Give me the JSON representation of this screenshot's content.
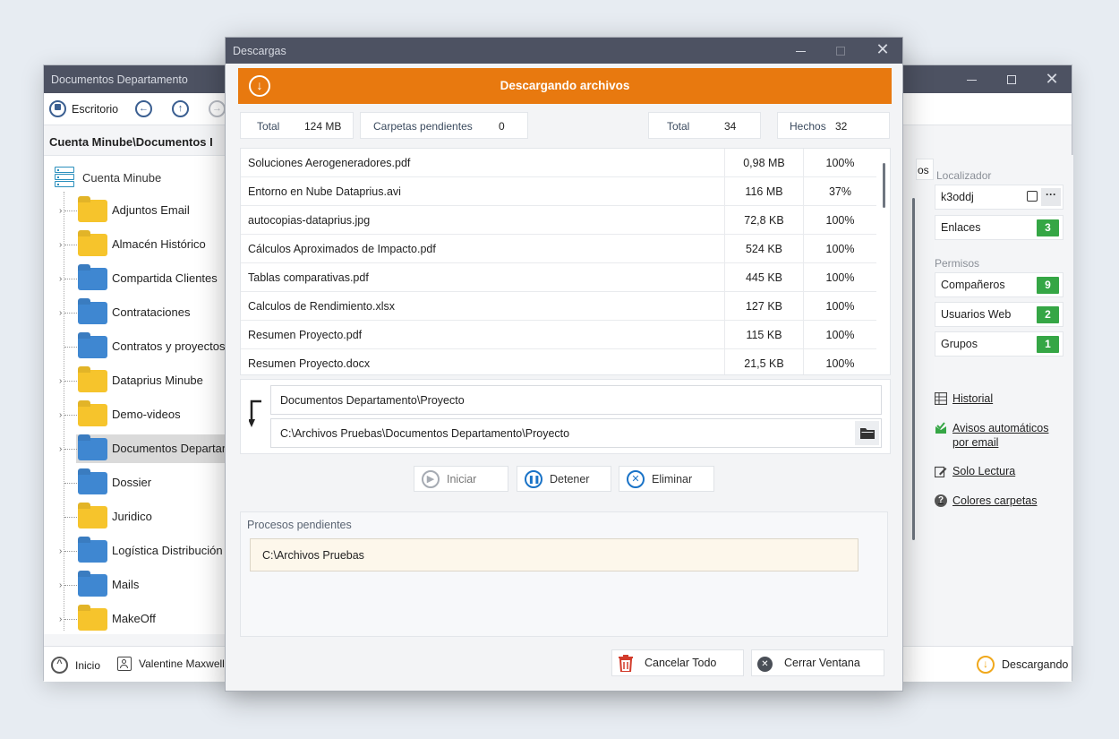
{
  "main_window": {
    "title": "Documentos Departamento",
    "toolbar": {
      "escritorio_label": "Escritorio"
    },
    "breadcrumb": "Cuenta Minube\\Documentos I",
    "tree": {
      "root_label": "Cuenta Minube",
      "items": [
        {
          "label": "Adjuntos Email",
          "color": "yellow",
          "has_children": true
        },
        {
          "label": "Almacén Histórico",
          "color": "yellow",
          "has_children": true
        },
        {
          "label": "Compartida Clientes",
          "color": "blue",
          "has_children": true
        },
        {
          "label": "Contrataciones",
          "color": "blue",
          "has_children": true
        },
        {
          "label": "Contratos y proyectos",
          "color": "blue",
          "has_children": false
        },
        {
          "label": "Dataprius Minube",
          "color": "yellow",
          "has_children": true
        },
        {
          "label": "Demo-videos",
          "color": "yellow",
          "has_children": true
        },
        {
          "label": "Documentos Departam",
          "color": "blue",
          "has_children": true,
          "selected": true
        },
        {
          "label": "Dossier",
          "color": "blue",
          "has_children": false
        },
        {
          "label": "Juridico",
          "color": "yellow",
          "has_children": false
        },
        {
          "label": "Logística Distribución",
          "color": "blue",
          "has_children": true
        },
        {
          "label": "Mails",
          "color": "blue",
          "has_children": true
        },
        {
          "label": "MakeOff",
          "color": "yellow",
          "has_children": true
        }
      ]
    },
    "statusbar": {
      "inicio_label": "Inicio",
      "user_label": "Valentine Maxwell",
      "downloading_label": "Descargando"
    },
    "right_panel": {
      "localizador_label": "Localizador",
      "localizador_value": "k3oddj",
      "enlaces_label": "Enlaces",
      "enlaces_count": "3",
      "permisos_label": "Permisos",
      "companeros_label": "Compañeros",
      "companeros_count": "9",
      "usuarios_web_label": "Usuarios Web",
      "usuarios_web_count": "2",
      "grupos_label": "Grupos",
      "grupos_count": "1",
      "historial_link": "Historial",
      "avisos_link_line1": "Avisos automáticos",
      "avisos_link_line2": "por email",
      "solo_lectura_link": "Solo Lectura",
      "colores_link": "Colores carpetas",
      "partial_tab": "os"
    }
  },
  "dialog": {
    "title": "Descargas",
    "banner_title": "Descargando archivos",
    "stats": {
      "size_total_label": "Total",
      "size_total_value": "124 MB",
      "pending_folders_label": "Carpetas pendientes",
      "pending_folders_value": "0",
      "files_total_label": "Total",
      "files_total_value": "34",
      "done_label": "Hechos",
      "done_value": "32"
    },
    "files": [
      {
        "name": "Soluciones Aerogeneradores.pdf",
        "size": "0,98 MB",
        "progress": "100%"
      },
      {
        "name": "Entorno en Nube Dataprius.avi",
        "size": "116 MB",
        "progress": "37%"
      },
      {
        "name": "autocopias-dataprius.jpg",
        "size": "72,8 KB",
        "progress": "100%"
      },
      {
        "name": "Cálculos Aproximados de Impacto.pdf",
        "size": "524 KB",
        "progress": "100%"
      },
      {
        "name": "Tablas comparativas.pdf",
        "size": "445 KB",
        "progress": "100%"
      },
      {
        "name": "Calculos de Rendimiento.xlsx",
        "size": "127 KB",
        "progress": "100%"
      },
      {
        "name": "Resumen Proyecto.pdf",
        "size": "115 KB",
        "progress": "100%"
      },
      {
        "name": "Resumen Proyecto.docx",
        "size": "21,5 KB",
        "progress": "100%"
      }
    ],
    "source_path": "Documentos Departamento\\Proyecto",
    "dest_path": "C:\\Archivos Pruebas\\Documentos Departamento\\Proyecto",
    "buttons": {
      "start": "Iniciar",
      "stop": "Detener",
      "delete": "Eliminar",
      "cancel_all": "Cancelar Todo",
      "close_window": "Cerrar Ventana"
    },
    "pending": {
      "title": "Procesos pendientes",
      "item": "C:\\Archivos Pruebas"
    }
  },
  "colors": {
    "titlebar": "#4d5262",
    "banner": "#e8790f",
    "badge": "#35a645",
    "accent_blue": "#1a73c7"
  }
}
